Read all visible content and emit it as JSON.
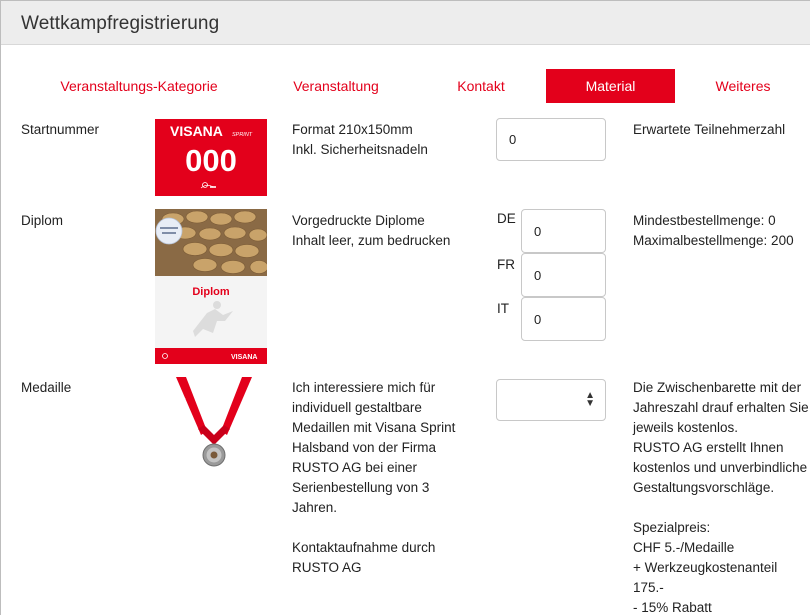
{
  "header": {
    "title": "Wettkampfregistrierung"
  },
  "tabs": [
    {
      "label": "Veranstaltungs-Kategorie"
    },
    {
      "label": "Veranstaltung"
    },
    {
      "label": "Kontakt"
    },
    {
      "label": "Material",
      "active": true
    },
    {
      "label": "Weiteres"
    }
  ],
  "colors": {
    "accent": "#e3001b",
    "header_bg": "#ededed"
  },
  "rows": {
    "startnummer": {
      "label": "Startnummer",
      "image": {
        "brand": "VISANA",
        "sub": "SPRINT",
        "number": "000"
      },
      "desc_lines": [
        "Format 210x150mm",
        "Inkl. Sicherheitsnadeln"
      ],
      "input_value": "0",
      "note": "Erwartete Teilnehmerzahl"
    },
    "diplom": {
      "label": "Diplom",
      "image": {
        "caption": "Diplom",
        "brand": "VISANA"
      },
      "desc_lines": [
        "Vorgedruckte Diplome",
        "Inhalt leer, zum bedrucken"
      ],
      "languages": [
        {
          "code": "DE",
          "value": "0"
        },
        {
          "code": "FR",
          "value": "0"
        },
        {
          "code": "IT",
          "value": "0"
        }
      ],
      "note_lines": [
        "Mindestbestellmenge: 0",
        "Maximalbestellmenge: 200"
      ]
    },
    "medaille": {
      "label": "Medaille",
      "desc_lines": [
        "Ich interessiere mich für",
        "individuell gestaltbare",
        "Medaillen mit Visana Sprint",
        "Halsband von der Firma",
        "RUSTO AG bei einer",
        "Serienbestellung von 3",
        "Jahren.",
        "",
        "Kontaktaufnahme durch",
        "RUSTO AG"
      ],
      "select_value": "",
      "note_lines": [
        "Die Zwischenbarette mit der",
        "Jahreszahl drauf erhalten Sie",
        "jeweils kostenlos.",
        "RUSTO AG erstellt Ihnen",
        "kostenlos und unverbindliche",
        "Gestaltungsvorschläge.",
        "",
        "Spezialpreis:",
        "CHF 5.-/Medaille",
        "+ Werkzeugkostenanteil 175.-",
        "- 15% Rabatt"
      ]
    }
  }
}
